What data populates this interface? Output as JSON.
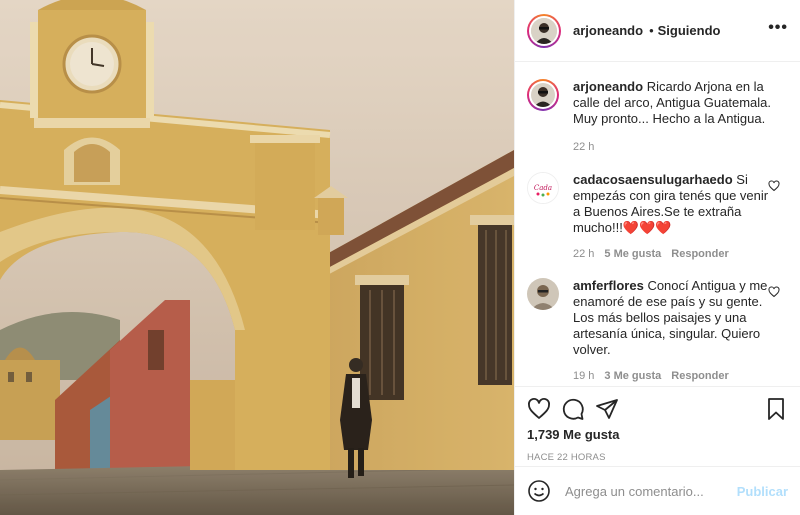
{
  "header": {
    "username": "arjoneando",
    "separator": "•",
    "follow_status": "Siguiendo",
    "more_icon": "more-dots-icon"
  },
  "comments": [
    {
      "username": "arjoneando",
      "text": "Ricardo Arjona en la calle del arco, Antigua Guatemala. Muy pronto... Hecho a la Antigua.",
      "time": "22 h"
    },
    {
      "username": "cadacosaensulugarhaedo",
      "text": "Si empezás con gira tenés que venir a Buenos Aires.Se te extraña mucho!!!❤️❤️❤️",
      "time": "22 h",
      "likes": "5 Me gusta",
      "reply": "Responder"
    },
    {
      "username": "amferflores",
      "text": "Conocí Antigua y me enamoré de ese país y su gente. Los más bellos paisajes y una artesanía única, singular. Quiero volver.",
      "time": "19 h",
      "likes": "3 Me gusta",
      "reply": "Responder"
    }
  ],
  "actions": {
    "icons": [
      "heart-icon",
      "comment-icon",
      "share-icon",
      "bookmark-icon"
    ],
    "likes": "1,739 Me gusta",
    "posted_ago": "HACE 22 HORAS"
  },
  "add_comment": {
    "placeholder": "Agrega un comentario...",
    "publish_label": "Publicar"
  },
  "colors": {
    "text": "#262626",
    "secondary": "#8e8e8e",
    "publish_disabled": "#b2dffc",
    "arch_yellow": "#d9b25e"
  }
}
